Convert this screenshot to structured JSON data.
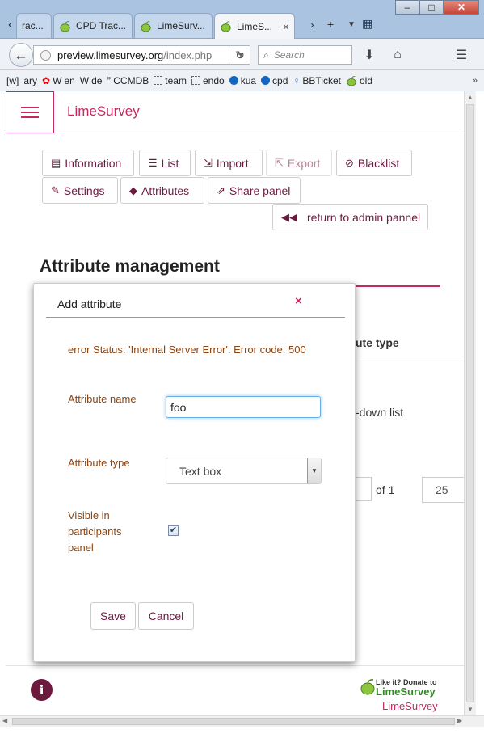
{
  "browser": {
    "tabs": [
      {
        "label": "rac..."
      },
      {
        "label": "CPD Trac..."
      },
      {
        "label": "LimeSurv..."
      },
      {
        "label": "LimeS..."
      }
    ],
    "url_domain": "preview.limesurvey.org",
    "url_path": "/index.php",
    "search_placeholder": "Search",
    "bookmarks": [
      {
        "label": "ary",
        "icon": "wiki-icon"
      },
      {
        "label": "en",
        "icon": "maple-leaf-icon"
      },
      {
        "label": "de",
        "icon": "wikipedia-icon"
      },
      {
        "label": "CCMDB",
        "icon": "wikipedia-icon"
      },
      {
        "label": "team",
        "icon": "dashed-square-icon"
      },
      {
        "label": "endo",
        "icon": "dashed-square-icon"
      },
      {
        "label": "kua",
        "icon": "blue-dot-icon"
      },
      {
        "label": "cpd",
        "icon": "blue-dot-icon"
      },
      {
        "label": "BBTicket",
        "icon": "ribbon-icon"
      },
      {
        "label": "old",
        "icon": "lime-icon"
      }
    ],
    "bookmark_prefix": "[w]",
    "bookmarks_more": "»"
  },
  "app": {
    "brand": "LimeSurvey"
  },
  "toolbar": {
    "information": "Information",
    "list": "List",
    "import": "Import",
    "export": "Export",
    "blacklist": "Blacklist",
    "settings": "Settings",
    "attributes": "Attributes",
    "share_panel": "Share panel",
    "return_admin": "return to admin pannel"
  },
  "main": {
    "title": "Attribute management",
    "col_header_partial": "ute type",
    "row_partial": "-down list",
    "pager_of": "of 1",
    "page_size": "25"
  },
  "modal": {
    "title": "Add attribute",
    "close_symbol": "×",
    "error": "error Status: 'Internal Server Error'. Error code: 500",
    "name_label": "Attribute name",
    "name_value": "foo",
    "type_label": "Attribute type",
    "type_value": "Text box",
    "visible_label_1": "Visible in",
    "visible_label_2": "participants",
    "visible_label_3": "panel",
    "visible_checked": true,
    "save": "Save",
    "cancel": "Cancel"
  },
  "footer": {
    "donate_small": "Like it? Donate to",
    "donate_big": "LimeSurvey",
    "brand": "LimeSurvey"
  },
  "colors": {
    "accent": "#c6285f",
    "button_text": "#6b1a3e",
    "label_text": "#8b4513"
  }
}
